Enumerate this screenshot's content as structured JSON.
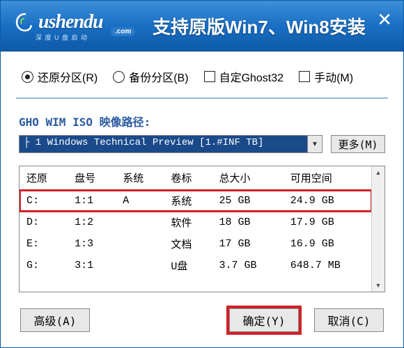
{
  "titlebar": {
    "logo_main": "ushendu",
    "logo_com": ".com",
    "logo_sub": "深 度 U 盘 启 动",
    "tagline": "支持原版Win7、Win8安装"
  },
  "options": {
    "restore_label": "还原分区(R)",
    "backup_label": "备份分区(B)",
    "ghost_label": "自定Ghost32",
    "manual_label": "手动(M)"
  },
  "path": {
    "label": "GHO WIM ISO 映像路径:",
    "combo_value": "├ 1 Windows Technical Preview [1.#INF TB]",
    "more_btn": "更多(M)"
  },
  "table": {
    "headers": [
      "还原",
      "盘号",
      "系统",
      "卷标",
      "总大小",
      "可用空间"
    ],
    "rows": [
      {
        "drive": "C:",
        "disk": "1:1",
        "sys": "A",
        "label": "系统",
        "total": "25 GB",
        "free": "24.9 GB",
        "selected": true
      },
      {
        "drive": "D:",
        "disk": "1:2",
        "sys": "",
        "label": "软件",
        "total": "18 GB",
        "free": "17.9 GB",
        "selected": false
      },
      {
        "drive": "E:",
        "disk": "1:3",
        "sys": "",
        "label": "文档",
        "total": "17 GB",
        "free": "16.9 GB",
        "selected": false
      },
      {
        "drive": "G:",
        "disk": "3:1",
        "sys": "",
        "label": "U盘",
        "total": "3.7 GB",
        "free": "648.7 MB",
        "selected": false
      }
    ]
  },
  "buttons": {
    "advanced": "高级(A)",
    "ok": "确定(Y)",
    "cancel": "取消(C)"
  }
}
